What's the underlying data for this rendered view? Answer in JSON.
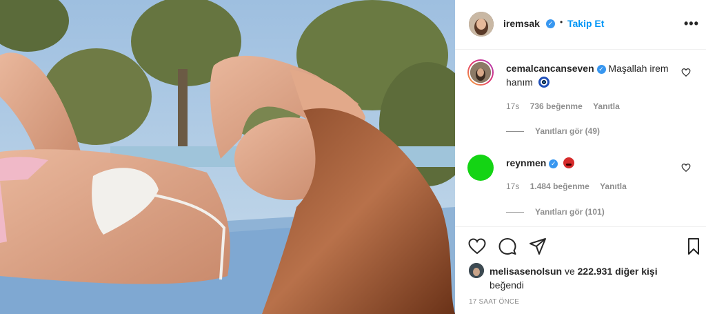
{
  "post": {
    "photo_alt": "",
    "author": {
      "username": "iremsak",
      "verified": true,
      "follow_label": "Takip Et",
      "separator": "•",
      "more_label": "•••"
    }
  },
  "comments": [
    {
      "username": "cemalcancanseven",
      "verified": true,
      "text": "Maşallah irem hanım",
      "emoji": "nazar-eye-emoji",
      "time": "17s",
      "likes": "736 beğenme",
      "reply_label": "Yanıtla",
      "view_replies": "Yanıtları gör (49)"
    },
    {
      "username": "reynmen",
      "verified": true,
      "text": "",
      "emoji": "angry-face-emoji",
      "avatar_color": "#14d414",
      "time": "17s",
      "likes": "1.484 beğenme",
      "reply_label": "Yanıtla",
      "view_replies": "Yanıtları gör (101)"
    }
  ],
  "actions": {
    "icons": [
      "heart-icon",
      "comment-icon",
      "share-icon",
      "bookmark-icon"
    ]
  },
  "likes": {
    "first_user": "melisasenolsun",
    "connector": "ve",
    "others": "222.931 diğer kişi",
    "suffix": "beğendi"
  },
  "timestamp": "17 SAAT ÖNCE",
  "colors": {
    "link_blue": "#0095f6",
    "verified_blue": "#3897f0",
    "muted": "#8e8e8e",
    "text": "#262626"
  }
}
